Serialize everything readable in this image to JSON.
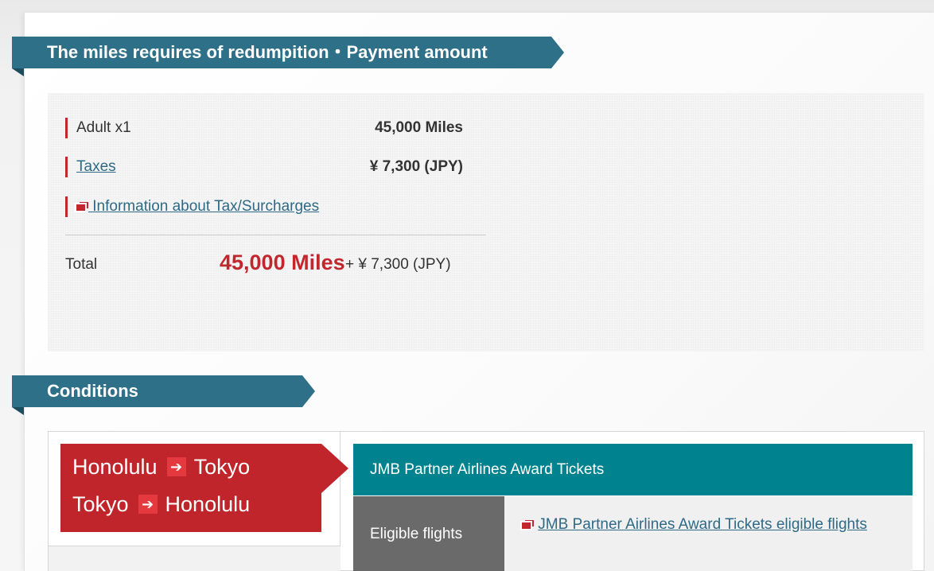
{
  "miles_section": {
    "title": "The miles requires of redumpition・Payment amount",
    "rows": [
      {
        "label": "Adult x1",
        "value": "45,000 Miles"
      },
      {
        "label": "Taxes",
        "value": "¥ 7,300 (JPY)"
      }
    ],
    "info_link": " Information about Tax/Surcharges",
    "total_label": "Total",
    "total_miles": "45,000 Miles",
    "total_plus": "+ ¥ 7,300 (JPY)"
  },
  "conditions_section": {
    "title": "Conditions",
    "routes": [
      {
        "from": "Honolulu",
        "to": "Tokyo"
      },
      {
        "from": "Tokyo",
        "to": "Honolulu"
      }
    ],
    "arrow_icon": "➔",
    "award_type": "JMB Partner Airlines Award Tickets",
    "eligible_label": "Eligible flights",
    "eligible_link": "JMB Partner Airlines Award Tickets eligible flights"
  },
  "colors": {
    "section_header": "#2e7088",
    "accent_red": "#c0282d",
    "teal_bar": "#00838f",
    "link": "#2e6a85"
  }
}
